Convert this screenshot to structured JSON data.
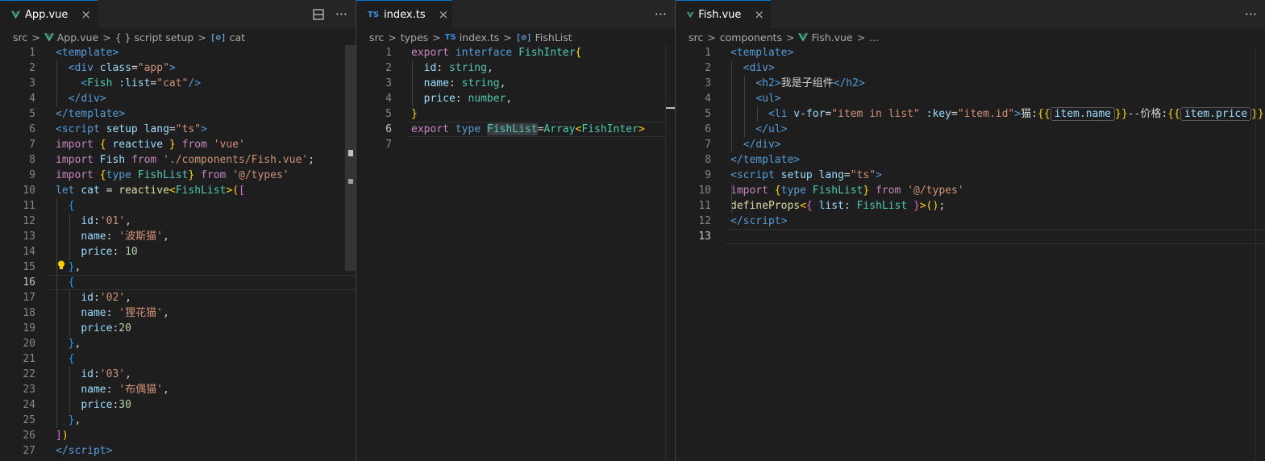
{
  "panes": [
    {
      "tab": {
        "label": "App.vue",
        "icon": "vue-icon"
      },
      "breadcrumbs": [
        "src",
        "App.vue",
        "{ } script setup",
        "cat"
      ]
    },
    {
      "tab": {
        "label": "index.ts",
        "icon": "ts-icon"
      },
      "breadcrumbs": [
        "src",
        "types",
        "index.ts",
        "FishList"
      ]
    },
    {
      "tab": {
        "label": "Fish.vue",
        "icon": "vue-icon"
      },
      "breadcrumbs": [
        "src",
        "components",
        "Fish.vue",
        "..."
      ]
    }
  ],
  "glyphs": {
    "close": "×",
    "more": "···",
    "sep": ">",
    "ts_badge": "TS",
    "sym_badge": "[⊘]"
  },
  "code": {
    "app": [
      {
        "n": "1",
        "t": [
          [
            "tg",
            "<"
          ],
          [
            "tn",
            "template"
          ],
          [
            "tg",
            ">"
          ]
        ]
      },
      {
        "n": "2",
        "t": [
          [
            "tx",
            "  "
          ],
          [
            "tg",
            "<"
          ],
          [
            "tn",
            "div"
          ],
          [
            "tx",
            " "
          ],
          [
            "at",
            "class"
          ],
          [
            "tx",
            "="
          ],
          [
            "st",
            "\"app\""
          ],
          [
            "tg",
            ">"
          ]
        ]
      },
      {
        "n": "3",
        "t": [
          [
            "tx",
            "    "
          ],
          [
            "tg",
            "<"
          ],
          [
            "ty",
            "Fish"
          ],
          [
            "tx",
            " "
          ],
          [
            "at",
            ":list"
          ],
          [
            "tx",
            "="
          ],
          [
            "st",
            "\"cat\""
          ],
          [
            "tg",
            "/>"
          ]
        ]
      },
      {
        "n": "4",
        "t": [
          [
            "tx",
            "  "
          ],
          [
            "tg",
            "</"
          ],
          [
            "tn",
            "div"
          ],
          [
            "tg",
            ">"
          ]
        ]
      },
      {
        "n": "5",
        "t": [
          [
            "tg",
            "</"
          ],
          [
            "tn",
            "template"
          ],
          [
            "tg",
            ">"
          ]
        ]
      },
      {
        "n": "6",
        "t": [
          [
            "tg",
            "<"
          ],
          [
            "tn",
            "script"
          ],
          [
            "tx",
            " "
          ],
          [
            "at",
            "setup"
          ],
          [
            "tx",
            " "
          ],
          [
            "at",
            "lang"
          ],
          [
            "tx",
            "="
          ],
          [
            "st",
            "\"ts\""
          ],
          [
            "tg",
            ">"
          ]
        ]
      },
      {
        "n": "7",
        "t": [
          [
            "kw",
            "import"
          ],
          [
            "tx",
            " "
          ],
          [
            "b1",
            "{"
          ],
          [
            "tx",
            " "
          ],
          [
            "id",
            "reactive"
          ],
          [
            "tx",
            " "
          ],
          [
            "b1",
            "}"
          ],
          [
            "tx",
            " "
          ],
          [
            "kw",
            "from"
          ],
          [
            "tx",
            " "
          ],
          [
            "st",
            "'vue'"
          ]
        ]
      },
      {
        "n": "8",
        "t": [
          [
            "kw",
            "import"
          ],
          [
            "tx",
            " "
          ],
          [
            "id",
            "Fish"
          ],
          [
            "tx",
            " "
          ],
          [
            "kw",
            "from"
          ],
          [
            "tx",
            " "
          ],
          [
            "st",
            "'./components/Fish.vue'"
          ],
          [
            "tx",
            ";"
          ]
        ]
      },
      {
        "n": "9",
        "t": [
          [
            "kw",
            "import"
          ],
          [
            "tx",
            " "
          ],
          [
            "b1",
            "{"
          ],
          [
            "kb",
            "type"
          ],
          [
            "tx",
            " "
          ],
          [
            "ty",
            "FishList"
          ],
          [
            "b1",
            "}"
          ],
          [
            "tx",
            " "
          ],
          [
            "kw",
            "from"
          ],
          [
            "tx",
            " "
          ],
          [
            "st",
            "'@/types'"
          ]
        ]
      },
      {
        "n": "10",
        "t": [
          [
            "kb",
            "let"
          ],
          [
            "tx",
            " "
          ],
          [
            "id",
            "cat"
          ],
          [
            "tx",
            " = "
          ],
          [
            "fn",
            "reactive"
          ],
          [
            "b1",
            "<"
          ],
          [
            "ty",
            "FishList"
          ],
          [
            "b1",
            ">"
          ],
          [
            "b1",
            "("
          ],
          [
            "b2",
            "["
          ]
        ]
      },
      {
        "n": "11",
        "t": [
          [
            "tx",
            "  "
          ],
          [
            "b3",
            "{"
          ]
        ]
      },
      {
        "n": "12",
        "t": [
          [
            "tx",
            "    "
          ],
          [
            "id",
            "id"
          ],
          [
            "tx",
            ":"
          ],
          [
            "st",
            "'01'"
          ],
          [
            "tx",
            ","
          ]
        ]
      },
      {
        "n": "13",
        "t": [
          [
            "tx",
            "    "
          ],
          [
            "id",
            "name"
          ],
          [
            "tx",
            ": "
          ],
          [
            "st",
            "'波斯猫'"
          ],
          [
            "tx",
            ","
          ]
        ]
      },
      {
        "n": "14",
        "t": [
          [
            "tx",
            "    "
          ],
          [
            "id",
            "price"
          ],
          [
            "tx",
            ": "
          ],
          [
            "nm",
            "10"
          ]
        ]
      },
      {
        "n": "15",
        "t": [
          [
            "tx",
            "  "
          ],
          [
            "b3",
            "}"
          ],
          [
            "tx",
            ","
          ]
        ]
      },
      {
        "n": "16",
        "t": [
          [
            "tx",
            "  "
          ],
          [
            "b3",
            "{"
          ]
        ]
      },
      {
        "n": "17",
        "t": [
          [
            "tx",
            "    "
          ],
          [
            "id",
            "id"
          ],
          [
            "tx",
            ":"
          ],
          [
            "st",
            "'02'"
          ],
          [
            "tx",
            ","
          ]
        ]
      },
      {
        "n": "18",
        "t": [
          [
            "tx",
            "    "
          ],
          [
            "id",
            "name"
          ],
          [
            "tx",
            ": "
          ],
          [
            "st",
            "'狸花猫'"
          ],
          [
            "tx",
            ","
          ]
        ]
      },
      {
        "n": "19",
        "t": [
          [
            "tx",
            "    "
          ],
          [
            "id",
            "price"
          ],
          [
            "tx",
            ":"
          ],
          [
            "nm",
            "20"
          ]
        ]
      },
      {
        "n": "20",
        "t": [
          [
            "tx",
            "  "
          ],
          [
            "b3",
            "}"
          ],
          [
            "tx",
            ","
          ]
        ]
      },
      {
        "n": "21",
        "t": [
          [
            "tx",
            "  "
          ],
          [
            "b3",
            "{"
          ]
        ]
      },
      {
        "n": "22",
        "t": [
          [
            "tx",
            "    "
          ],
          [
            "id",
            "id"
          ],
          [
            "tx",
            ":"
          ],
          [
            "st",
            "'03'"
          ],
          [
            "tx",
            ","
          ]
        ]
      },
      {
        "n": "23",
        "t": [
          [
            "tx",
            "    "
          ],
          [
            "id",
            "name"
          ],
          [
            "tx",
            ": "
          ],
          [
            "st",
            "'布偶猫'"
          ],
          [
            "tx",
            ","
          ]
        ]
      },
      {
        "n": "24",
        "t": [
          [
            "tx",
            "    "
          ],
          [
            "id",
            "price"
          ],
          [
            "tx",
            ":"
          ],
          [
            "nm",
            "30"
          ]
        ]
      },
      {
        "n": "25",
        "t": [
          [
            "tx",
            "  "
          ],
          [
            "b3",
            "}"
          ],
          [
            "tx",
            ","
          ]
        ]
      },
      {
        "n": "26",
        "t": [
          [
            "b2",
            "]"
          ],
          [
            "b1",
            ")"
          ]
        ]
      },
      {
        "n": "27",
        "t": [
          [
            "tg",
            "</"
          ],
          [
            "tn",
            "script"
          ],
          [
            "tg",
            ">"
          ]
        ]
      }
    ],
    "index": [
      {
        "n": "1",
        "t": [
          [
            "kw",
            "export"
          ],
          [
            "tx",
            " "
          ],
          [
            "kb",
            "interface"
          ],
          [
            "tx",
            " "
          ],
          [
            "ty",
            "FishInter"
          ],
          [
            "b1",
            "{"
          ]
        ]
      },
      {
        "n": "2",
        "t": [
          [
            "tx",
            "  "
          ],
          [
            "id",
            "id"
          ],
          [
            "tx",
            ": "
          ],
          [
            "ty",
            "string"
          ],
          [
            "tx",
            ","
          ]
        ]
      },
      {
        "n": "3",
        "t": [
          [
            "tx",
            "  "
          ],
          [
            "id",
            "name"
          ],
          [
            "tx",
            ": "
          ],
          [
            "ty",
            "string"
          ],
          [
            "tx",
            ","
          ]
        ]
      },
      {
        "n": "4",
        "t": [
          [
            "tx",
            "  "
          ],
          [
            "id",
            "price"
          ],
          [
            "tx",
            ": "
          ],
          [
            "ty",
            "number"
          ],
          [
            "tx",
            ","
          ]
        ]
      },
      {
        "n": "5",
        "t": [
          [
            "b1",
            "}"
          ]
        ]
      },
      {
        "n": "6",
        "t": [
          [
            "kw",
            "export"
          ],
          [
            "tx",
            " "
          ],
          [
            "kb",
            "type"
          ],
          [
            "tx",
            " "
          ],
          [
            "ty hlw",
            "FishList"
          ],
          [
            "tx",
            "="
          ],
          [
            "ty",
            "Array"
          ],
          [
            "b1",
            "<"
          ],
          [
            "ty",
            "FishInter"
          ],
          [
            "b1",
            ">"
          ]
        ]
      },
      {
        "n": "7",
        "t": []
      }
    ],
    "fish": [
      {
        "n": "1",
        "t": [
          [
            "tg",
            "<"
          ],
          [
            "tn",
            "template"
          ],
          [
            "tg",
            ">"
          ]
        ]
      },
      {
        "n": "2",
        "t": [
          [
            "tx",
            "  "
          ],
          [
            "tg",
            "<"
          ],
          [
            "tn",
            "div"
          ],
          [
            "tg",
            ">"
          ]
        ]
      },
      {
        "n": "3",
        "t": [
          [
            "tx",
            "    "
          ],
          [
            "tg",
            "<"
          ],
          [
            "tn",
            "h2"
          ],
          [
            "tg",
            ">"
          ],
          [
            "tx",
            "我是子组件"
          ],
          [
            "tg",
            "</"
          ],
          [
            "tn",
            "h2"
          ],
          [
            "tg",
            ">"
          ]
        ]
      },
      {
        "n": "4",
        "t": [
          [
            "tx",
            "    "
          ],
          [
            "tg",
            "<"
          ],
          [
            "tn",
            "ul"
          ],
          [
            "tg",
            ">"
          ]
        ]
      },
      {
        "n": "5",
        "t": [
          [
            "tx",
            "      "
          ],
          [
            "tg",
            "<"
          ],
          [
            "tn",
            "li"
          ],
          [
            "tx",
            " "
          ],
          [
            "at",
            "v-for"
          ],
          [
            "tx",
            "="
          ],
          [
            "st",
            "\"item in list\""
          ],
          [
            "tx",
            " "
          ],
          [
            "at",
            ":key"
          ],
          [
            "tx",
            "="
          ],
          [
            "st",
            "\"item.id\""
          ],
          [
            "tg",
            ">"
          ],
          [
            "tx",
            "猫:"
          ],
          [
            "b1",
            "{{"
          ],
          [
            "inlay",
            "item.name"
          ],
          [
            "b1",
            "}}"
          ],
          [
            "tx",
            "--价格:"
          ],
          [
            "b1",
            "{{"
          ],
          [
            "inlay",
            "item.price"
          ],
          [
            "b1",
            "}}"
          ]
        ]
      },
      {
        "n": "6",
        "t": [
          [
            "tx",
            "    "
          ],
          [
            "tg",
            "</"
          ],
          [
            "tn",
            "ul"
          ],
          [
            "tg",
            ">"
          ]
        ]
      },
      {
        "n": "7",
        "t": [
          [
            "tx",
            "  "
          ],
          [
            "tg",
            "</"
          ],
          [
            "tn",
            "div"
          ],
          [
            "tg",
            ">"
          ]
        ]
      },
      {
        "n": "8",
        "t": [
          [
            "tg",
            "</"
          ],
          [
            "tn",
            "template"
          ],
          [
            "tg",
            ">"
          ]
        ]
      },
      {
        "n": "9",
        "t": [
          [
            "tg",
            "<"
          ],
          [
            "tn",
            "script"
          ],
          [
            "tx",
            " "
          ],
          [
            "at",
            "setup"
          ],
          [
            "tx",
            " "
          ],
          [
            "at",
            "lang"
          ],
          [
            "tx",
            "="
          ],
          [
            "st",
            "\"ts\""
          ],
          [
            "tg",
            ">"
          ]
        ]
      },
      {
        "n": "10",
        "t": [
          [
            "kw",
            "import"
          ],
          [
            "tx",
            " "
          ],
          [
            "b1",
            "{"
          ],
          [
            "kb",
            "type"
          ],
          [
            "tx",
            " "
          ],
          [
            "ty",
            "FishList"
          ],
          [
            "b1",
            "}"
          ],
          [
            "tx",
            " "
          ],
          [
            "kw",
            "from"
          ],
          [
            "tx",
            " "
          ],
          [
            "st",
            "'@/types'"
          ]
        ]
      },
      {
        "n": "11",
        "t": [
          [
            "fn",
            "defineProps"
          ],
          [
            "b1",
            "<"
          ],
          [
            "b2",
            "{"
          ],
          [
            "tx",
            " "
          ],
          [
            "id",
            "list"
          ],
          [
            "tx",
            ": "
          ],
          [
            "ty",
            "FishList"
          ],
          [
            "tx",
            " "
          ],
          [
            "b2",
            "}"
          ],
          [
            "b1",
            ">"
          ],
          [
            "b1",
            "("
          ],
          [
            "b1",
            ")"
          ],
          [
            "tx",
            ";"
          ]
        ]
      },
      {
        "n": "12",
        "t": [
          [
            "tg",
            "</"
          ],
          [
            "tn",
            "script"
          ],
          [
            "tg",
            ">"
          ]
        ]
      },
      {
        "n": "13",
        "t": []
      }
    ]
  },
  "current_lines": {
    "app": "16",
    "index": "6",
    "fish": "13"
  }
}
